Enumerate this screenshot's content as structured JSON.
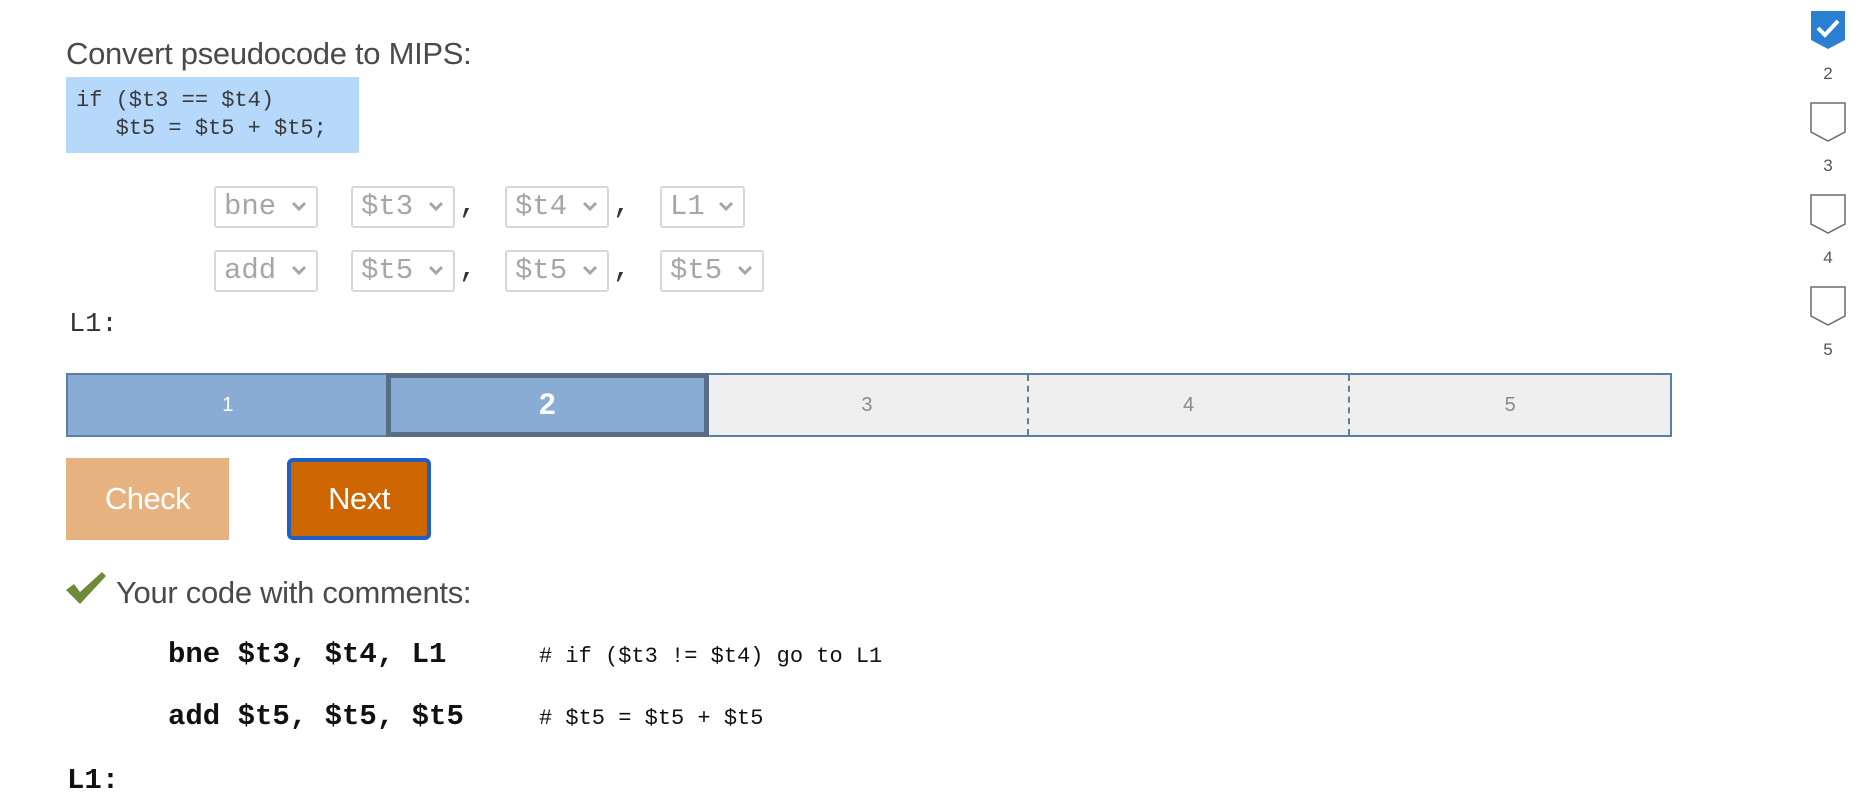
{
  "prompt": "Convert pseudocode to MIPS:",
  "pseudocode": [
    "if ($t3 == $t4)",
    "   $t5 = $t5 + $t5;"
  ],
  "instructions": [
    {
      "op": "bne",
      "arg1": "$t3",
      "arg2": "$t4",
      "arg3": "L1"
    },
    {
      "op": "add",
      "arg1": "$t5",
      "arg2": "$t5",
      "arg3": "$t5"
    }
  ],
  "comma": ",",
  "label_line": "L1:",
  "levels": [
    "1",
    "2",
    "3",
    "4",
    "5"
  ],
  "current_level": "2",
  "buttons": {
    "check": "Check",
    "next": "Next"
  },
  "feedback": {
    "title": "Your code with comments:",
    "lines": [
      {
        "code": "bne $t3, $t4, L1",
        "comment": "# if ($t3 != $t4) go to L1"
      },
      {
        "code": "add $t5, $t5, $t5",
        "comment": "# $t5 = $t5 + $t5"
      }
    ],
    "label": "L1:"
  },
  "progress": [
    {
      "number": "2",
      "status": "completed"
    },
    {
      "number": "3",
      "status": "incomplete"
    },
    {
      "number": "4",
      "status": "incomplete"
    },
    {
      "number": "5",
      "status": "incomplete"
    }
  ],
  "colors": {
    "pseudocode_bg": "#b5d8fb",
    "level_filled": "#88acd4",
    "check_button": "#e5b280",
    "next_button": "#cd6500",
    "completed_badge": "#2b7fd2"
  }
}
